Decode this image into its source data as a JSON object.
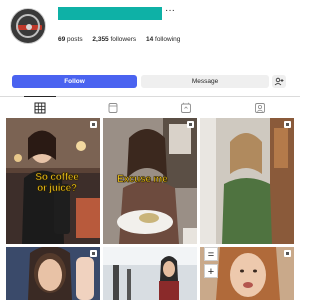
{
  "profile": {
    "username_display_color": "#0eb1a6",
    "more_glyph": "···"
  },
  "stats": {
    "posts_count": "69",
    "posts_label": "posts",
    "followers_count": "2,355",
    "followers_label": "followers",
    "following_count": "14",
    "following_label": "following"
  },
  "actions": {
    "follow_label": "Follow",
    "message_label": "Message",
    "suggest_icon": "add-person-icon",
    "follow_color": "#4a63f0"
  },
  "tabs": [
    {
      "icon": "grid-icon",
      "active": true
    },
    {
      "icon": "reels-icon",
      "active": false
    },
    {
      "icon": "repost-icon",
      "active": false
    },
    {
      "icon": "tagged-icon",
      "active": false
    }
  ],
  "posts": {
    "post1": {
      "caption": "So coffee or juice?"
    },
    "post2": {
      "caption": "Excuse me"
    },
    "caption_color": "#ffd21f",
    "plus_glyph": "+",
    "equal_glyph": "="
  }
}
